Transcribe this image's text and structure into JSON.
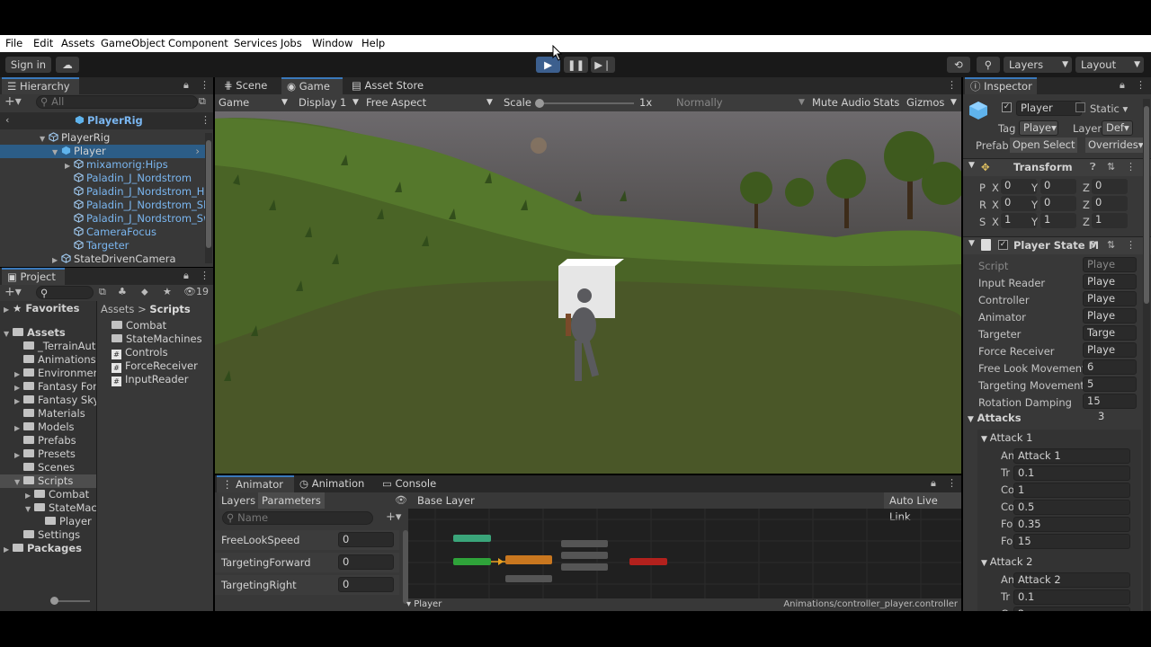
{
  "menu": [
    "File",
    "Edit",
    "Assets",
    "GameObject",
    "Component",
    "Services",
    "Jobs",
    "Window",
    "Help"
  ],
  "toolbar": {
    "signin": "Sign in",
    "layers": "Layers",
    "layout": "Layout"
  },
  "hierarchy": {
    "tab": "Hierarchy",
    "search": "All",
    "scene": "PlayerRig",
    "items": [
      {
        "label": "PlayerRig",
        "indent": 0,
        "blue": false,
        "sel": false,
        "arrow": "▼"
      },
      {
        "label": "Player",
        "indent": 1,
        "blue": false,
        "sel": true,
        "arrow": "▼"
      },
      {
        "label": "mixamorig:Hips",
        "indent": 2,
        "blue": true,
        "sel": false,
        "arrow": "▶"
      },
      {
        "label": "Paladin_J_Nordstrom",
        "indent": 2,
        "blue": true,
        "sel": false,
        "arrow": ""
      },
      {
        "label": "Paladin_J_Nordstrom_He",
        "indent": 2,
        "blue": true,
        "sel": false,
        "arrow": ""
      },
      {
        "label": "Paladin_J_Nordstrom_Sh",
        "indent": 2,
        "blue": true,
        "sel": false,
        "arrow": ""
      },
      {
        "label": "Paladin_J_Nordstrom_Sw",
        "indent": 2,
        "blue": true,
        "sel": false,
        "arrow": ""
      },
      {
        "label": "CameraFocus",
        "indent": 2,
        "blue": true,
        "sel": false,
        "arrow": ""
      },
      {
        "label": "Targeter",
        "indent": 2,
        "blue": true,
        "sel": false,
        "arrow": ""
      },
      {
        "label": "StateDrivenCamera",
        "indent": 1,
        "blue": false,
        "sel": false,
        "arrow": "▶"
      }
    ]
  },
  "project": {
    "tab": "Project",
    "count": "19",
    "favorites": "Favorites",
    "breadcrumb": [
      "Assets",
      "Scripts"
    ],
    "tree": [
      {
        "label": "Assets",
        "indent": 0,
        "bold": true,
        "arrow": "▼",
        "sel": false
      },
      {
        "label": "_TerrainAut",
        "indent": 1,
        "bold": false,
        "arrow": "",
        "sel": false
      },
      {
        "label": "Animations",
        "indent": 1,
        "bold": false,
        "arrow": "",
        "sel": false
      },
      {
        "label": "Environmen",
        "indent": 1,
        "bold": false,
        "arrow": "▶",
        "sel": false
      },
      {
        "label": "Fantasy For",
        "indent": 1,
        "bold": false,
        "arrow": "▶",
        "sel": false
      },
      {
        "label": "Fantasy Sky",
        "indent": 1,
        "bold": false,
        "arrow": "▶",
        "sel": false
      },
      {
        "label": "Materials",
        "indent": 1,
        "bold": false,
        "arrow": "",
        "sel": false
      },
      {
        "label": "Models",
        "indent": 1,
        "bold": false,
        "arrow": "▶",
        "sel": false
      },
      {
        "label": "Prefabs",
        "indent": 1,
        "bold": false,
        "arrow": "",
        "sel": false
      },
      {
        "label": "Presets",
        "indent": 1,
        "bold": false,
        "arrow": "▶",
        "sel": false
      },
      {
        "label": "Scenes",
        "indent": 1,
        "bold": false,
        "arrow": "",
        "sel": false
      },
      {
        "label": "Scripts",
        "indent": 1,
        "bold": false,
        "arrow": "▼",
        "sel": true
      },
      {
        "label": "Combat",
        "indent": 2,
        "bold": false,
        "arrow": "▶",
        "sel": false
      },
      {
        "label": "StateMac",
        "indent": 2,
        "bold": false,
        "arrow": "▼",
        "sel": false
      },
      {
        "label": "Player",
        "indent": 3,
        "bold": false,
        "arrow": "",
        "sel": false
      },
      {
        "label": "Settings",
        "indent": 1,
        "bold": false,
        "arrow": "",
        "sel": false
      },
      {
        "label": "Packages",
        "indent": 0,
        "bold": true,
        "arrow": "▶",
        "sel": false
      }
    ],
    "files": [
      {
        "label": "Combat",
        "type": "folder"
      },
      {
        "label": "StateMachines",
        "type": "folder"
      },
      {
        "label": "Controls",
        "type": "script"
      },
      {
        "label": "ForceReceiver",
        "type": "script"
      },
      {
        "label": "InputReader",
        "type": "script"
      }
    ]
  },
  "scene": {
    "tabs": [
      "Scene",
      "Game",
      "Asset Store"
    ],
    "display": "Game",
    "display_target": "Display 1",
    "aspect": "Free Aspect",
    "scale_label": "Scale",
    "scale_value": "1x",
    "normally": "Normally",
    "mute": "Mute Audio",
    "stats": "Stats",
    "gizmos": "Gizmos"
  },
  "animator": {
    "tabs": [
      "Animator",
      "Animation",
      "Console"
    ],
    "sub": [
      "Layers",
      "Parameters"
    ],
    "base_layer": "Base Layer",
    "auto_live": "Auto Live Link",
    "search": "Name",
    "params": [
      {
        "name": "FreeLookSpeed",
        "value": "0"
      },
      {
        "name": "TargetingForward",
        "value": "0"
      },
      {
        "name": "TargetingRight",
        "value": "0"
      }
    ],
    "footer_left": "Player",
    "footer_right": "Animations/controller_player.controller"
  },
  "inspector": {
    "tab": "Inspector",
    "name": "Player",
    "static": "Static",
    "tag_label": "Tag",
    "tag": "Playe",
    "layer_label": "Layer",
    "layer": "Def",
    "prefab_label": "Prefab",
    "open": "Open",
    "select": "Select",
    "overrides": "Overrides",
    "transform": {
      "title": "Transform",
      "rows": [
        {
          "l": "P",
          "vals": [
            "0",
            "0",
            "0"
          ]
        },
        {
          "l": "R",
          "vals": [
            "0",
            "0",
            "0"
          ]
        },
        {
          "l": "S",
          "vals": [
            "1",
            "1",
            "1"
          ]
        }
      ],
      "axes": [
        "X",
        "Y",
        "Z"
      ]
    },
    "component": {
      "title": "Player State M",
      "fields": [
        {
          "label": "Script",
          "value": "Playe",
          "dim": true
        },
        {
          "label": "Input Reader",
          "value": "Playe"
        },
        {
          "label": "Controller",
          "value": "Playe"
        },
        {
          "label": "Animator",
          "value": "Playe"
        },
        {
          "label": "Targeter",
          "value": "Targe"
        },
        {
          "label": "Force Receiver",
          "value": "Playe"
        },
        {
          "label": "Free Look Movement",
          "value": "6"
        },
        {
          "label": "Targeting Movement",
          "value": "5"
        },
        {
          "label": "Rotation Damping",
          "value": "15"
        }
      ]
    },
    "attacks": {
      "label": "Attacks",
      "count": "3",
      "items": [
        {
          "title": "Attack 1",
          "fields": [
            {
              "l": "An",
              "v": "Attack 1"
            },
            {
              "l": "Tr",
              "v": "0.1"
            },
            {
              "l": "Co",
              "v": "1"
            },
            {
              "l": "Co",
              "v": "0.5"
            },
            {
              "l": "Fo",
              "v": "0.35"
            },
            {
              "l": "Fo",
              "v": "15"
            }
          ]
        },
        {
          "title": "Attack 2",
          "fields": [
            {
              "l": "An",
              "v": "Attack 2"
            },
            {
              "l": "Tr",
              "v": "0.1"
            },
            {
              "l": "Co",
              "v": "2"
            }
          ]
        }
      ]
    }
  }
}
